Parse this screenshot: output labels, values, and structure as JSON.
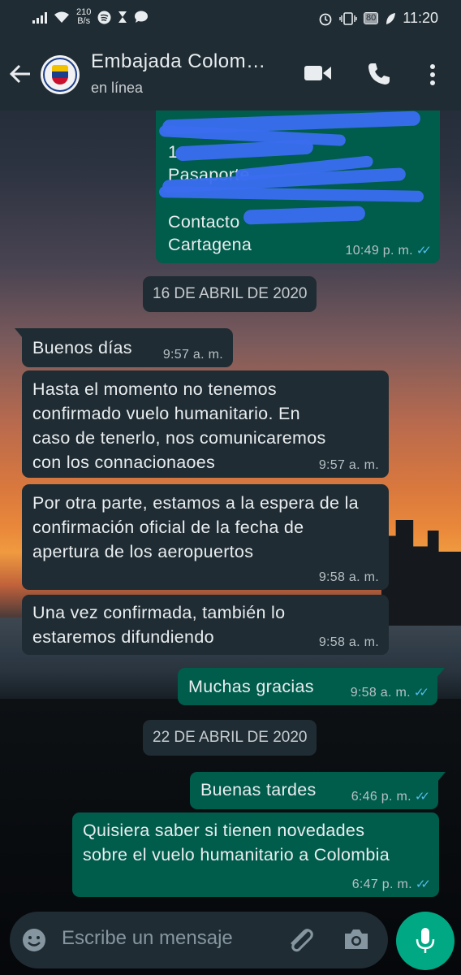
{
  "status_bar": {
    "speed_value": "210",
    "speed_unit": "B/s",
    "battery": "80",
    "time": "11:20"
  },
  "header": {
    "title": "Embajada Colom…",
    "subtitle": "en línea"
  },
  "messages": [
    {
      "direction": "outgoing",
      "lines": [
        "1",
        "Pasaporte",
        "Contacto",
        "Cartagena"
      ],
      "time": "10:49 p. m."
    },
    {
      "type": "date",
      "label": "16 DE ABRIL DE 2020"
    },
    {
      "direction": "incoming",
      "text": "Buenos días",
      "time": "9:57 a. m."
    },
    {
      "direction": "incoming",
      "text": "Hasta el momento no tenemos confirmado vuelo humanitario. En caso de tenerlo, nos comunicaremos con los connacionaoes",
      "time": "9:57 a. m."
    },
    {
      "direction": "incoming",
      "text": "Por otra parte, estamos a la espera de la confirmación oficial de la fecha de apertura de los aeropuertos",
      "time": "9:58 a. m."
    },
    {
      "direction": "incoming",
      "text": "Una vez confirmada, también lo estaremos difundiendo",
      "time": "9:58 a. m."
    },
    {
      "direction": "outgoing",
      "text": "Muchas gracias",
      "time": "9:58 a. m."
    },
    {
      "type": "date",
      "label": "22 DE ABRIL DE 2020"
    },
    {
      "direction": "outgoing",
      "text": "Buenas tardes",
      "time": "6:46 p. m."
    },
    {
      "direction": "outgoing",
      "text": "Quisiera saber si tienen novedades sobre el vuelo humanitario a Colombia",
      "time": "6:47 p. m."
    }
  ],
  "input": {
    "placeholder": "Escribe un mensaje"
  },
  "icons": {
    "back": "arrow-left-icon",
    "video": "video-call-icon",
    "call": "phone-icon",
    "menu": "more-vert-icon",
    "emoji": "emoji-icon",
    "attach": "paperclip-icon",
    "camera": "camera-icon",
    "mic": "microphone-icon"
  },
  "colors": {
    "header_bg": "#1f2c33",
    "incoming_bubble": "#1f2c33",
    "outgoing_bubble": "#005c4b",
    "read_ticks": "#53bdeb",
    "mic_button": "#00a884"
  }
}
